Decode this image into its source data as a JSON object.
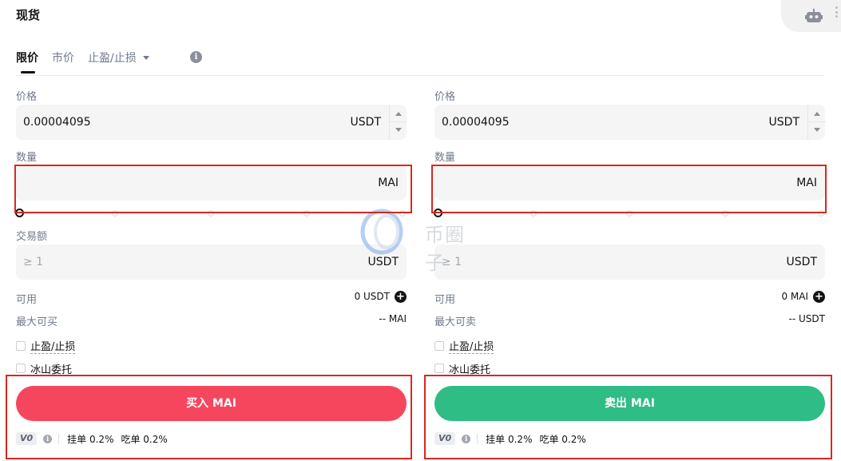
{
  "header": {
    "title": "现货"
  },
  "tabs": [
    {
      "label": "限价",
      "active": true
    },
    {
      "label": "市价",
      "active": false
    },
    {
      "label": "止盈/止损",
      "active": false
    }
  ],
  "buy": {
    "price_label": "价格",
    "price_value": "0.00004095",
    "price_unit": "USDT",
    "qty_label": "数量",
    "qty_value": "",
    "qty_unit": "MAI",
    "amount_label": "交易额",
    "amount_placeholder": "≥ 1",
    "amount_unit": "USDT",
    "avail_label": "可用",
    "avail_value": "0 USDT",
    "max_label": "最大可买",
    "max_value": "-- MAI",
    "tpsl_label": "止盈/止损",
    "iceberg_label": "冰山委托",
    "action_label": "买入 MAI",
    "vip": "V0",
    "maker_fee": "挂单 0.2%",
    "taker_fee": "吃单 0.2%",
    "slider_percent": 0
  },
  "sell": {
    "price_label": "价格",
    "price_value": "0.00004095",
    "price_unit": "USDT",
    "qty_label": "数量",
    "qty_value": "",
    "qty_unit": "MAI",
    "amount_placeholder": "≥ 1",
    "amount_unit": "USDT",
    "avail_label": "可用",
    "avail_value": "0 MAI",
    "max_label": "最大可卖",
    "max_value": "-- USDT",
    "tpsl_label": "止盈/止损",
    "iceberg_label": "冰山委托",
    "action_label": "卖出 MAI",
    "vip": "V0",
    "maker_fee": "挂单 0.2%",
    "taker_fee": "吃单 0.2%",
    "slider_percent": 0
  },
  "watermark": {
    "text": "币圈子"
  },
  "colors": {
    "buy": "#f6465d",
    "sell": "#2ebd85",
    "highlight": "#d9281f"
  }
}
